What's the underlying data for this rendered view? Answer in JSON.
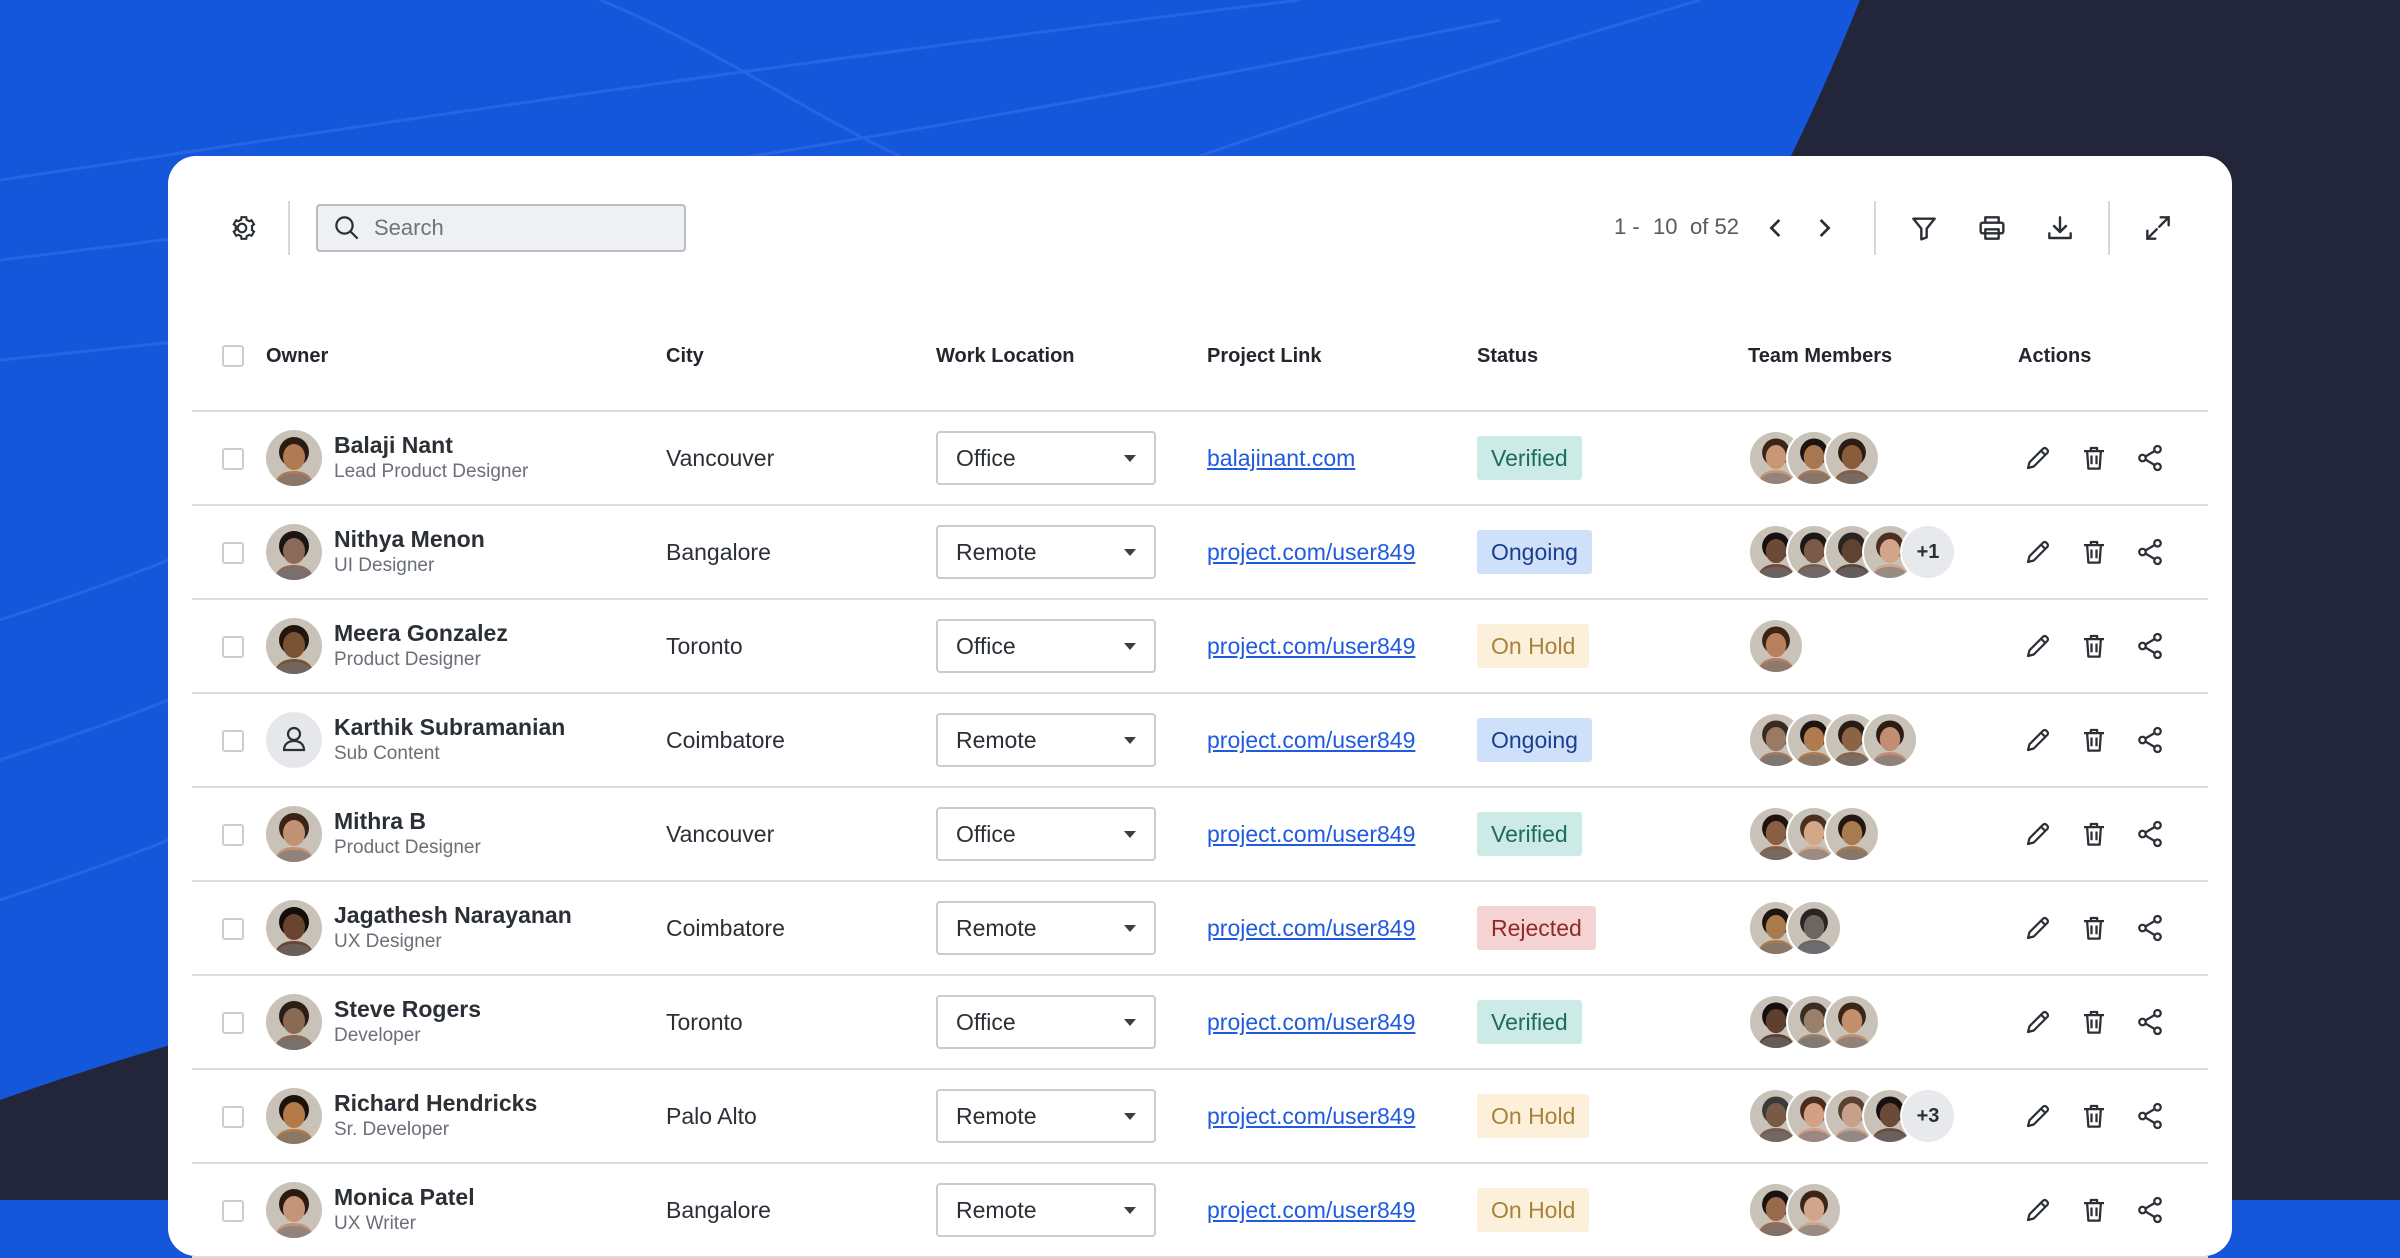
{
  "colors": {
    "background": "#1457db",
    "dark_corner": "#23263a",
    "link": "#1f5ae0",
    "status": {
      "Verified": {
        "bg": "#cdebe6",
        "fg": "#1e6a5f"
      },
      "Ongoing": {
        "bg": "#cfe0fa",
        "fg": "#1b3f8f"
      },
      "On Hold": {
        "bg": "#fdf0da",
        "fg": "#a7823e"
      },
      "Rejected": {
        "bg": "#f6d3d3",
        "fg": "#8e2a2a"
      }
    }
  },
  "toolbar": {
    "settings_icon": "gear-icon",
    "search_placeholder": "Search",
    "search_value": "",
    "pager": {
      "range_start": "1 -",
      "range_end": "10",
      "total": "of 52"
    },
    "icons": [
      "chevron-left-icon",
      "chevron-right-icon",
      "filter-icon",
      "printer-icon",
      "download-icon",
      "expand-icon"
    ]
  },
  "table": {
    "columns": [
      "Owner",
      "City",
      "Work Location",
      "Project Link",
      "Status",
      "Team Members",
      "Actions"
    ],
    "rows": [
      {
        "name": "Balaji Nant",
        "role": "Lead Product Designer",
        "city": "Vancouver",
        "location": "Office",
        "link": "balajinant.com",
        "status": "Verified",
        "avatar": {
          "skin": "#b07a52",
          "hair": "#2a1c14"
        },
        "members": [
          {
            "skin": "#c99575",
            "hair": "#3a2618"
          },
          {
            "skin": "#a8774f",
            "hair": "#1e1410"
          },
          {
            "skin": "#8a5c3c",
            "hair": "#2b1d14"
          }
        ],
        "more": ""
      },
      {
        "name": "Nithya Menon",
        "role": "UI Designer",
        "city": "Bangalore",
        "location": "Remote",
        "link": "project.com/user849",
        "status": "Ongoing",
        "avatar": {
          "skin": "#8c6a58",
          "hair": "#1a1412"
        },
        "members": [
          {
            "skin": "#6d4a36",
            "hair": "#161010"
          },
          {
            "skin": "#7c5a48",
            "hair": "#1c1614"
          },
          {
            "skin": "#5e4232",
            "hair": "#2a2420"
          },
          {
            "skin": "#d2a48a",
            "hair": "#4a2e20"
          }
        ],
        "more": "+1"
      },
      {
        "name": "Meera Gonzalez",
        "role": "Product Designer",
        "city": "Toronto",
        "location": "Office",
        "link": "project.com/user849",
        "status": "On Hold",
        "avatar": {
          "skin": "#7a5232",
          "hair": "#20160e"
        },
        "members": [
          {
            "skin": "#b8805c",
            "hair": "#3a2416"
          }
        ],
        "more": ""
      },
      {
        "name": "Karthik Subramanian",
        "role": "Sub Content",
        "city": "Coimbatore",
        "location": "Remote",
        "link": "project.com/user849",
        "status": "Ongoing",
        "avatar": {
          "skin": "placeholder",
          "hair": ""
        },
        "members": [
          {
            "skin": "#9a7a62",
            "hair": "#3a2a20"
          },
          {
            "skin": "#b07a4c",
            "hair": "#1e1410"
          },
          {
            "skin": "#8a6444",
            "hair": "#2a1c12"
          },
          {
            "skin": "#c28d72",
            "hair": "#2c1c14"
          }
        ],
        "more": ""
      },
      {
        "name": "Mithra B",
        "role": "Product Designer",
        "city": "Vancouver",
        "location": "Office",
        "link": "project.com/user849",
        "status": "Verified",
        "avatar": {
          "skin": "#c29274",
          "hair": "#3a2416"
        },
        "members": [
          {
            "skin": "#8a5e40",
            "hair": "#1e140e"
          },
          {
            "skin": "#d4a688",
            "hair": "#4a3020"
          },
          {
            "skin": "#a87a50",
            "hair": "#22160e"
          }
        ],
        "more": ""
      },
      {
        "name": "Jagathesh Narayanan",
        "role": "UX Designer",
        "city": "Coimbatore",
        "location": "Remote",
        "link": "project.com/user849",
        "status": "Rejected",
        "avatar": {
          "skin": "#6a4430",
          "hair": "#140e0a"
        },
        "members": [
          {
            "skin": "#a87a4c",
            "hair": "#1e140c"
          },
          {
            "skin": "#6e6460",
            "hair": "#2a2422"
          }
        ],
        "more": ""
      },
      {
        "name": "Steve Rogers",
        "role": "Developer",
        "city": "Toronto",
        "location": "Office",
        "link": "project.com/user849",
        "status": "Verified",
        "avatar": {
          "skin": "#8a6a52",
          "hair": "#2a1e16"
        },
        "members": [
          {
            "skin": "#5e3e2c",
            "hair": "#141010"
          },
          {
            "skin": "#9a8068",
            "hair": "#3a2e24"
          },
          {
            "skin": "#c2906c",
            "hair": "#3a2618"
          }
        ],
        "more": ""
      },
      {
        "name": "Richard Hendricks",
        "role": "Sr. Developer",
        "city": "Palo Alto",
        "location": "Remote",
        "link": "project.com/user849",
        "status": "On Hold",
        "avatar": {
          "skin": "#b27a46",
          "hair": "#1c120c"
        },
        "members": [
          {
            "skin": "#7a5a44",
            "hair": "#3a3a3a"
          },
          {
            "skin": "#d4a084",
            "hair": "#4a2c1c"
          },
          {
            "skin": "#c8a08a",
            "hair": "#5a4030"
          },
          {
            "skin": "#6a4a38",
            "hair": "#161010"
          }
        ],
        "more": "+3"
      },
      {
        "name": "Monica Patel",
        "role": "UX Writer",
        "city": "Bangalore",
        "location": "Remote",
        "link": "project.com/user849",
        "status": "On Hold",
        "avatar": {
          "skin": "#c49478",
          "hair": "#2a1a12"
        },
        "members": [
          {
            "skin": "#9a6a4c",
            "hair": "#1a1210"
          },
          {
            "skin": "#d2a48a",
            "hair": "#3a2418"
          }
        ],
        "more": ""
      }
    ],
    "action_icons": [
      "pencil-icon",
      "trash-icon",
      "share-icon"
    ]
  }
}
